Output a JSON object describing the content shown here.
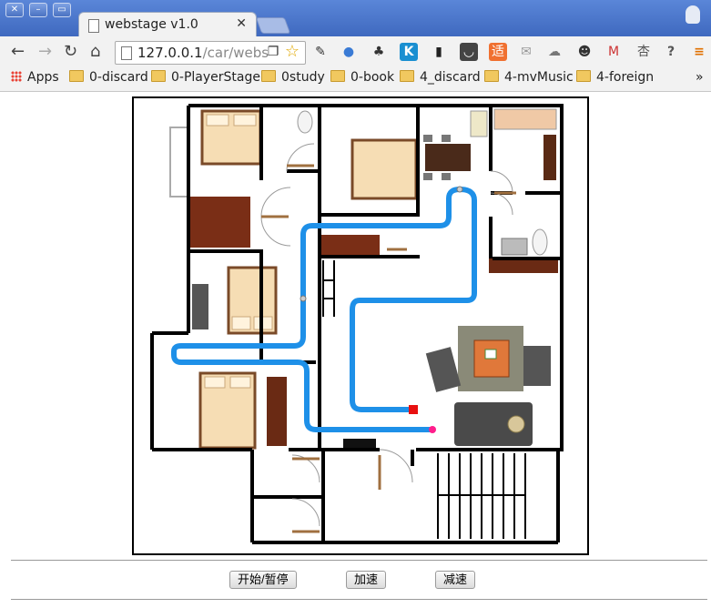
{
  "browser": {
    "tab_title": "webstage v1.0",
    "url_host": "127.0.0.1",
    "url_path": "/car/webs",
    "bookmarks": [
      {
        "label": "Apps",
        "type": "apps"
      },
      {
        "label": "0-discard",
        "type": "folder"
      },
      {
        "label": "0-PlayerStage",
        "type": "folder"
      },
      {
        "label": "0study",
        "type": "folder"
      },
      {
        "label": "0-book",
        "type": "folder"
      },
      {
        "label": "4_discard",
        "type": "folder"
      },
      {
        "label": "4-mvMusic",
        "type": "folder"
      },
      {
        "label": "4-foreign",
        "type": "folder"
      }
    ],
    "overflow": "»"
  },
  "controls": {
    "start_pause": "开始/暂停",
    "speed_up": "加速",
    "slow_down": "减速"
  },
  "map": {
    "path_color": "#1e90e8",
    "robot_color": "#ff1e8c",
    "goal_color": "#e81010",
    "wall_color": "#000000"
  }
}
